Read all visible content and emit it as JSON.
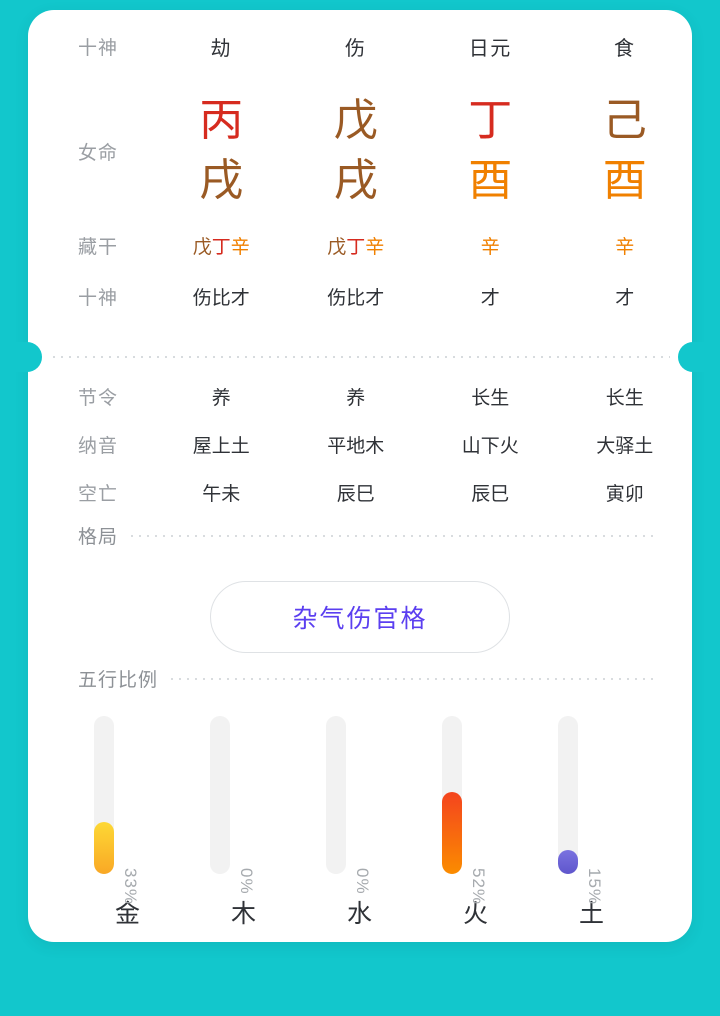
{
  "theme": {
    "background": "#12c7cc",
    "card_background": "#ffffff",
    "label_color": "#9a9ea3",
    "text_color": "#2f3237",
    "accent_purple": "#5b3ff0",
    "element_colors": {
      "fire_red": "#d62b1f",
      "earth_brown": "#9a5a24",
      "metal_orange": "#f08000",
      "gold_yellow": "#fbc02d",
      "water_blue": "#6b63d6"
    }
  },
  "chart_header": {
    "ten_gods_label": "十神",
    "ten_gods": [
      "劫",
      "伤",
      "日元",
      "食"
    ],
    "gender_label": "女命",
    "pillars": [
      {
        "stem": "丙",
        "stem_color": "#d62b1f",
        "branch": "戌",
        "branch_color": "#9a5a24"
      },
      {
        "stem": "戊",
        "stem_color": "#9a5a24",
        "branch": "戌",
        "branch_color": "#9a5a24"
      },
      {
        "stem": "丁",
        "stem_color": "#d62b1f",
        "branch": "酉",
        "branch_color": "#f08000"
      },
      {
        "stem": "己",
        "stem_color": "#9a5a24",
        "branch": "酉",
        "branch_color": "#f08000"
      }
    ],
    "hidden_stems_label": "藏干",
    "hidden_stems": [
      [
        {
          "char": "戊",
          "color": "#9a5a24"
        },
        {
          "char": "丁",
          "color": "#d62b1f"
        },
        {
          "char": "辛",
          "color": "#f08000"
        }
      ],
      [
        {
          "char": "戊",
          "color": "#9a5a24"
        },
        {
          "char": "丁",
          "color": "#d62b1f"
        },
        {
          "char": "辛",
          "color": "#f08000"
        }
      ],
      [
        {
          "char": "辛",
          "color": "#f08000"
        }
      ],
      [
        {
          "char": "辛",
          "color": "#f08000"
        }
      ]
    ],
    "hidden_ten_gods_label": "十神",
    "hidden_ten_gods": [
      "伤比才",
      "伤比才",
      "才",
      "才"
    ]
  },
  "detail_rows": [
    {
      "label": "节令",
      "values": [
        "养",
        "养",
        "长生",
        "长生"
      ]
    },
    {
      "label": "纳音",
      "values": [
        "屋上土",
        "平地木",
        "山下火",
        "大驿土"
      ]
    },
    {
      "label": "空亡",
      "values": [
        "午未",
        "辰巳",
        "辰巳",
        "寅卯"
      ]
    }
  ],
  "pattern": {
    "label": "格局",
    "value": "杂气伤官格"
  },
  "wuxing": {
    "label": "五行比例"
  },
  "chart_data": {
    "type": "bar",
    "title": "五行比例",
    "xlabel": "",
    "ylabel": "",
    "ylim": [
      0,
      100
    ],
    "grid": false,
    "orientation": "vertical",
    "categories": [
      "金",
      "木",
      "水",
      "火",
      "土"
    ],
    "values": [
      33,
      0,
      0,
      52,
      15
    ],
    "value_labels": [
      "33%",
      "0%",
      "0%",
      "52%",
      "15%"
    ],
    "bar_colors": [
      "#fbc02d",
      "#f2f2f2",
      "#f2f2f2",
      "#f4511e",
      "#6b63d6"
    ],
    "bar_gradients": [
      "linear-gradient(180deg, #fdd835 0%, #f9a825 100%)",
      "none",
      "none",
      "linear-gradient(180deg, #f4441e 0%, #fb8c00 100%)",
      "linear-gradient(180deg, #7a72e0 0%, #5f56cc 100%)"
    ],
    "track_color": "#f2f2f2"
  }
}
